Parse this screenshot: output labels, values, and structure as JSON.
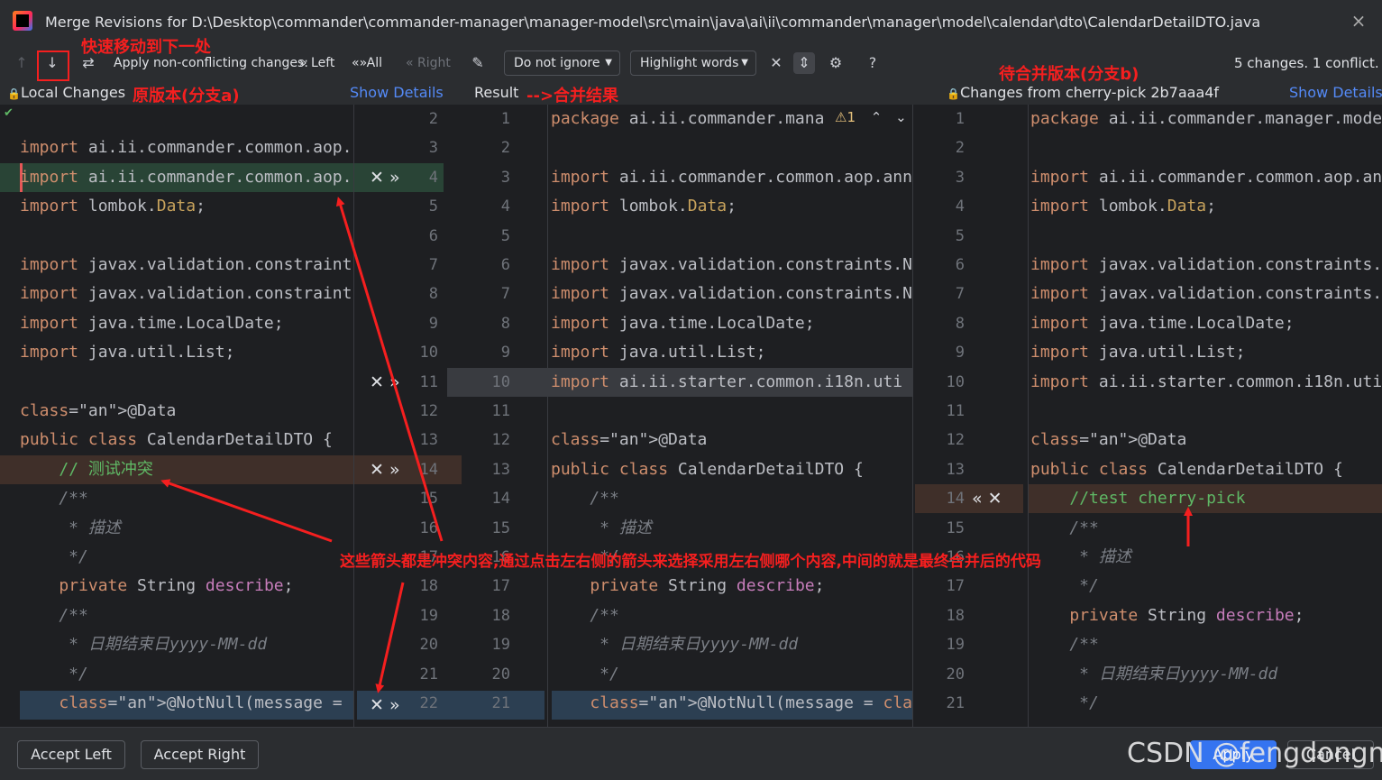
{
  "window": {
    "title": "Merge Revisions for D:\\Desktop\\commander\\commander-manager\\manager-model\\src\\main\\java\\ai\\ii\\commander\\manager\\model\\calendar\\dto\\CalendarDetailDTO.java",
    "close_icon": "×"
  },
  "toolbar": {
    "apply_label": "Apply non-conflicting changes:",
    "left_label": "Left",
    "all_label": "All",
    "right_label": "Right",
    "ignore_combo": "Do not ignore",
    "highlight_combo": "Highlight words",
    "help_label": "?",
    "changes_status": "5 changes. 1 conflict."
  },
  "panes": {
    "left_title": "Local Changes",
    "left_show_details": "Show Details",
    "center_title": "Result",
    "right_title": "Changes from cherry-pick 2b7aaa4f",
    "right_show_details": "Show Details",
    "conflict_count": "1"
  },
  "annotations": {
    "next_diff": "快速移动到下一处",
    "original": "原版本(分支a)",
    "merge_result": "-->合并结果",
    "incoming": "待合并版本(分支b)",
    "explanation": "这些箭头都是冲突内容,通过点击左右侧的箭头来选择采用左右侧哪个内容,中间的就是最终合并后的代码"
  },
  "code": {
    "left": [
      "import ai.ii.commander.common.aop.",
      "import ai.ii.commander.common.aop.",
      "import lombok.Data;",
      "",
      "import javax.validation.constraint",
      "import javax.validation.constraint",
      "import java.time.LocalDate;",
      "import java.util.List;",
      "",
      "@Data",
      "public class CalendarDetailDTO {",
      "    // 测试冲突",
      "    /**",
      "     * 描述",
      "     */",
      "    private String describe;",
      "    /**",
      "     * 日期结束日yyyy-MM-dd",
      "     */",
      "    @NotNull(message = \"结束时间不能"
    ],
    "left_nums": [
      "2",
      "3",
      "4",
      "5",
      "6",
      "7",
      "8",
      "9",
      "10",
      "11",
      "12",
      "13",
      "14",
      "15",
      "16",
      "17",
      "18",
      "19",
      "20",
      "21",
      "22"
    ],
    "center": [
      "package ai.ii.commander.mana",
      "",
      "import ai.ii.commander.common.aop.ann",
      "import lombok.Data;",
      "",
      "import javax.validation.constraints.N",
      "import javax.validation.constraints.N",
      "import java.time.LocalDate;",
      "import java.util.List;",
      "import ai.ii.starter.common.i18n.uti",
      "",
      "@Data",
      "public class CalendarDetailDTO {",
      "    /**",
      "     * 描述",
      "     */",
      "    private String describe;",
      "    /**",
      "     * 日期结束日yyyy-MM-dd",
      "     */",
      "    @NotNull(message = \"{end_time_can"
    ],
    "center_nums": [
      "1",
      "2",
      "3",
      "4",
      "5",
      "6",
      "7",
      "8",
      "9",
      "10",
      "11",
      "12",
      "13",
      "14",
      "15",
      "16",
      "17",
      "18",
      "19",
      "20",
      "21"
    ],
    "right": [
      "package ai.ii.commander.manager.mode",
      "",
      "import ai.ii.commander.common.aop.an",
      "import lombok.Data;",
      "",
      "import javax.validation.constraints.",
      "import javax.validation.constraints.",
      "import java.time.LocalDate;",
      "import java.util.List;",
      "import ai.ii.starter.common.i18n.uti",
      "",
      "@Data",
      "public class CalendarDetailDTO {",
      "    //test cherry-pick",
      "    /**",
      "     * 描述",
      "     */",
      "    private String describe;",
      "    /**",
      "     * 日期结束日yyyy-MM-dd",
      "     */"
    ],
    "right_nums": [
      "1",
      "2",
      "3",
      "4",
      "5",
      "6",
      "7",
      "8",
      "9",
      "10",
      "11",
      "12",
      "13",
      "14",
      "15",
      "16",
      "17",
      "18",
      "19",
      "20",
      "21"
    ]
  },
  "footer": {
    "accept_left": "Accept Left",
    "accept_right": "Accept Right",
    "apply": "Apply",
    "cancel": "Cancel",
    "watermark": "CSDN @fengdongnan"
  }
}
